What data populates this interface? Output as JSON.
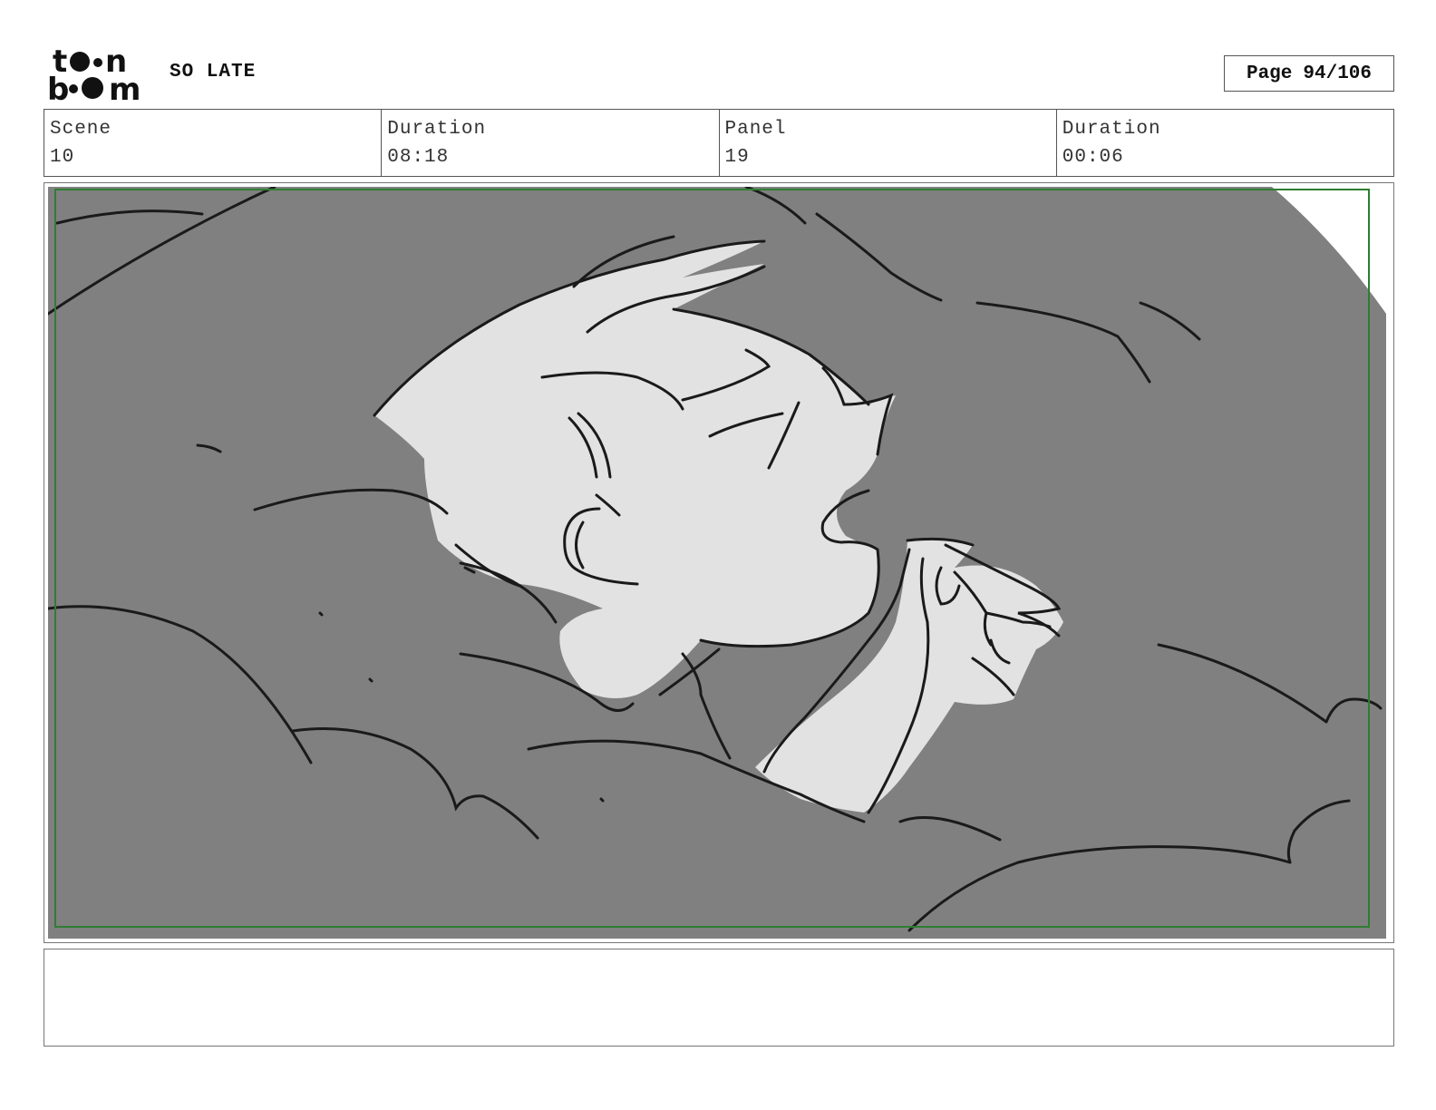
{
  "header": {
    "logo_text": "toon boom",
    "project_title": "SO LATE",
    "page_label": "Page",
    "page_number": "94/106"
  },
  "info": [
    {
      "label": "Scene",
      "value": "10"
    },
    {
      "label": "Duration",
      "value": "08:18"
    },
    {
      "label": "Panel",
      "value": "19"
    },
    {
      "label": "Duration",
      "value": "00:06"
    }
  ],
  "panel": {
    "background_color": "#808080",
    "character_fill": "#e2e2e2",
    "line_color": "#1a1a1a",
    "safe_frame_color": "#2e7d32"
  },
  "notes": {
    "text": ""
  }
}
